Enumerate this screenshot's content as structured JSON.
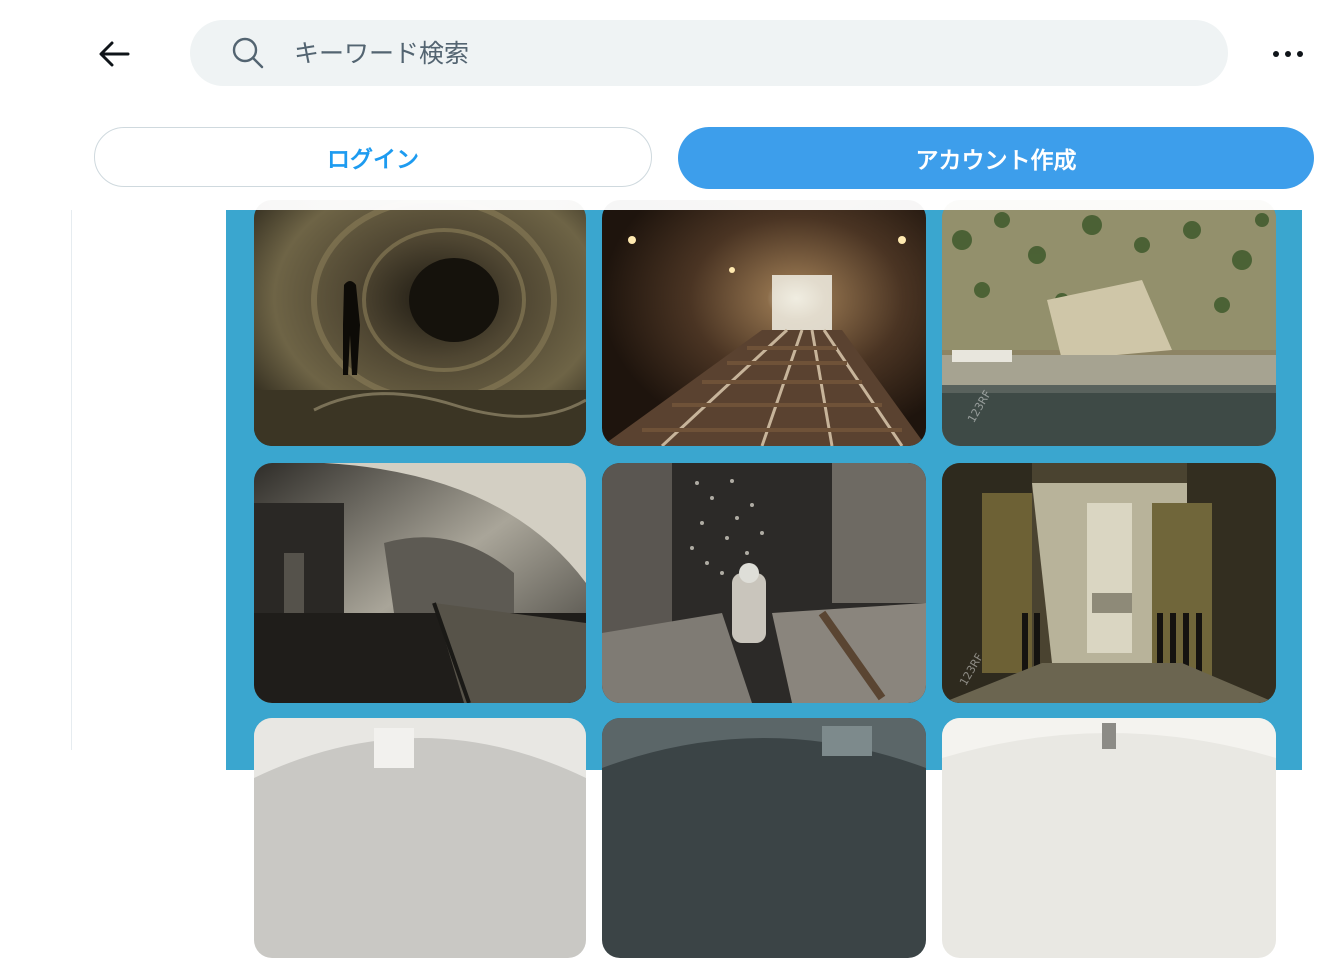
{
  "header": {
    "search": {
      "placeholder": "キーワード検索",
      "value": ""
    },
    "login_label": "ログイン",
    "signup_label": "アカウント作成"
  },
  "colors": {
    "accent": "#1d9bf0",
    "signup_bg": "#3d9eeb",
    "search_bg": "#eff3f4",
    "media_panel_bg": "#3aa6cf"
  },
  "media_grid": {
    "tiles": [
      {
        "name": "photo-round-tunnel-person"
      },
      {
        "name": "photo-metro-tunnel-tracks"
      },
      {
        "name": "photo-cliff-bunker-entrance",
        "watermark": "123RF"
      },
      {
        "name": "photo-submarine-base-canal"
      },
      {
        "name": "photo-soldier-in-trench"
      },
      {
        "name": "photo-bunker-blast-door",
        "watermark": "123RF"
      },
      {
        "name": "photo-partial-1"
      },
      {
        "name": "photo-partial-2"
      },
      {
        "name": "photo-partial-3"
      }
    ]
  }
}
